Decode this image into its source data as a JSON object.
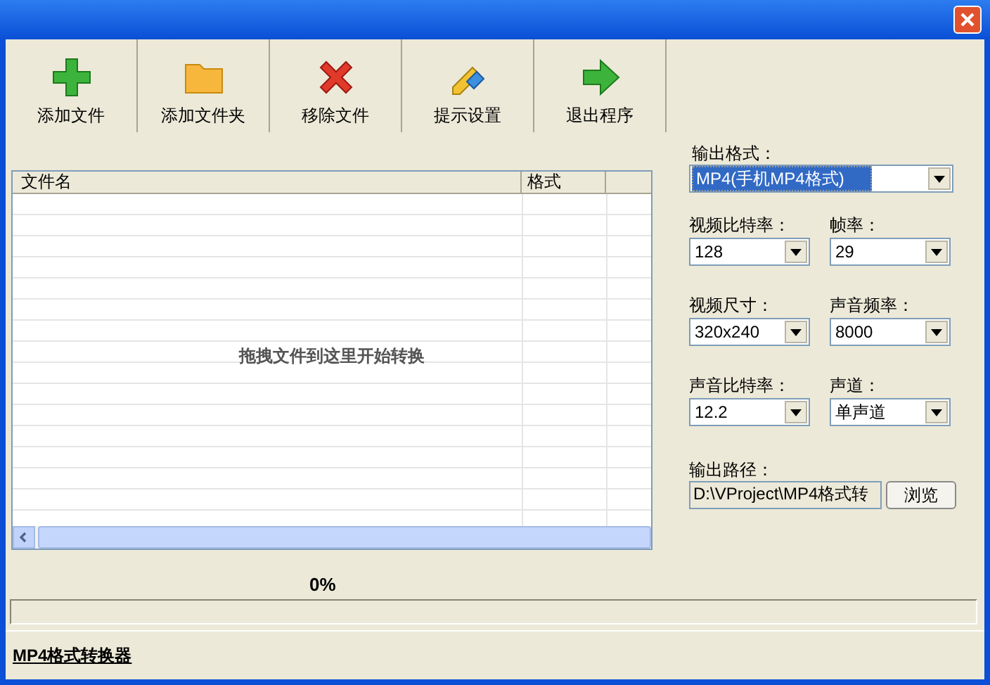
{
  "toolbar": [
    {
      "label": "添加文件",
      "kind": "add"
    },
    {
      "label": "添加文件夹",
      "kind": "folder"
    },
    {
      "label": "移除文件",
      "kind": "remove"
    },
    {
      "label": "提示设置",
      "kind": "settings"
    },
    {
      "label": "退出程序",
      "kind": "exit"
    }
  ],
  "file_list": {
    "columns": [
      "文件名",
      "格式"
    ],
    "empty_hint": "拖拽文件到这里开始转换"
  },
  "progress": {
    "reading": "0%",
    "level": 0
  },
  "status_bar": {
    "text": "MP4格式转换器"
  },
  "settings": {
    "output_format": {
      "label": "输出格式：",
      "value": "MP4(手机MP4格式)"
    },
    "pairs": [
      [
        {
          "label": "视频比特率：",
          "value": "128"
        },
        {
          "label": "帧率：",
          "value": "29"
        }
      ],
      [
        {
          "label": "视频尺寸：",
          "value": "320x240"
        },
        {
          "label": "声音频率：",
          "value": "8000"
        }
      ],
      [
        {
          "label": "声音比特率：",
          "value": "12.2"
        },
        {
          "label": "声道：",
          "value": "单声道"
        }
      ]
    ],
    "output_path": {
      "label": "输出路径：",
      "value": "D:\\VProject\\MP4格式转",
      "browse": "浏览"
    }
  }
}
